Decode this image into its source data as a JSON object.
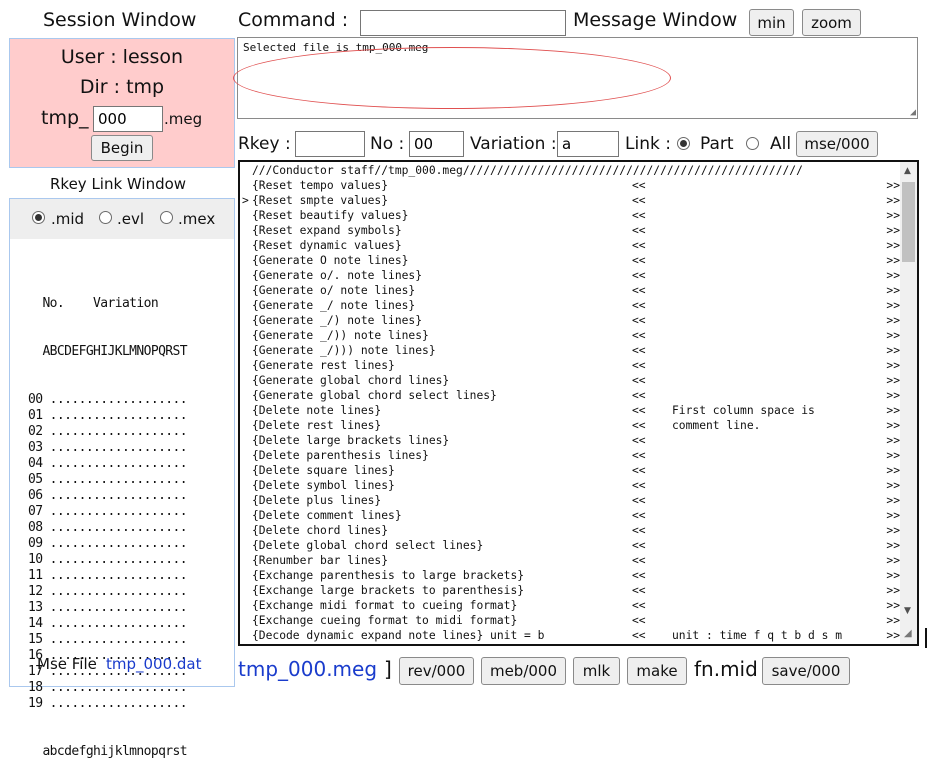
{
  "session": {
    "title": "Session Window",
    "user_label": "User : lesson",
    "dir_label": "Dir : tmp",
    "file_prefix": "tmp_",
    "file_number": "000",
    "file_ext": ".meg",
    "begin_label": "Begin"
  },
  "rkey_link": {
    "title": "Rkey Link Window",
    "options": [
      {
        "label": ".mid",
        "selected": true
      },
      {
        "label": ".evl",
        "selected": false
      },
      {
        "label": ".mex",
        "selected": false
      }
    ],
    "header_line1": "  No.    Variation",
    "header_line2": "  ABCDEFGHIJKLMNOPQRST",
    "rows": [
      "00 ...................",
      "01 ...................",
      "02 ...................",
      "03 ...................",
      "04 ...................",
      "05 ...................",
      "06 ...................",
      "07 ...................",
      "08 ...................",
      "09 ...................",
      "10 ...................",
      "11 ...................",
      "12 ...................",
      "13 ...................",
      "14 ...................",
      "15 ...................",
      "16 ...................",
      "17 ...................",
      "18 ...................",
      "19 ..................."
    ],
    "footer_line": "  abcdefghijklmnopqrst",
    "mse_file_label": "Mse File",
    "mse_file_link": "tmp_000.dat"
  },
  "command": {
    "label": "Command :",
    "value": ""
  },
  "message_window": {
    "label": "Message Window",
    "min_label": "min",
    "zoom_label": "zoom",
    "text": "Selected file is tmp_000.meg"
  },
  "controls": {
    "rkey_label": "Rkey :",
    "rkey_value": "",
    "no_label": "No :",
    "no_value": "00",
    "variation_label": "Variation :",
    "variation_value": "a",
    "link_label": "Link :",
    "part_label": "Part",
    "all_label": "All",
    "part_selected": true,
    "mse_button": "mse/000"
  },
  "editor": {
    "lines": [
      {
        "p": " ",
        "a": "///Conductor staff//tmp_000.meg//////////////////////////////////////////////////",
        "b": "",
        "c": "",
        "d": ""
      },
      {
        "p": " ",
        "a": "{Reset tempo values}",
        "b": "<<",
        "c": "",
        "d": ">>"
      },
      {
        "p": ">",
        "a": "{Reset smpte values}",
        "b": "<<",
        "c": "",
        "d": ">>"
      },
      {
        "p": " ",
        "a": "{Reset beautify values}",
        "b": "<<",
        "c": "",
        "d": ">>"
      },
      {
        "p": " ",
        "a": "{Reset expand symbols}",
        "b": "<<",
        "c": "",
        "d": ">>"
      },
      {
        "p": " ",
        "a": "{Reset dynamic values}",
        "b": "<<",
        "c": "",
        "d": ">>"
      },
      {
        "p": " ",
        "a": "{Generate O note lines}",
        "b": "<<",
        "c": "",
        "d": ">>"
      },
      {
        "p": " ",
        "a": "{Generate o/. note lines}",
        "b": "<<",
        "c": "",
        "d": ">>"
      },
      {
        "p": " ",
        "a": "{Generate o/ note lines}",
        "b": "<<",
        "c": "",
        "d": ">>"
      },
      {
        "p": " ",
        "a": "{Generate _/ note lines}",
        "b": "<<",
        "c": "",
        "d": ">>"
      },
      {
        "p": " ",
        "a": "{Generate _/) note lines}",
        "b": "<<",
        "c": "",
        "d": ">>"
      },
      {
        "p": " ",
        "a": "{Generate _/)) note lines}",
        "b": "<<",
        "c": "",
        "d": ">>"
      },
      {
        "p": " ",
        "a": "{Generate _/))) note lines}",
        "b": "<<",
        "c": "",
        "d": ">>"
      },
      {
        "p": " ",
        "a": "{Generate rest lines}",
        "b": "<<",
        "c": "",
        "d": ">>"
      },
      {
        "p": " ",
        "a": "{Generate global chord lines}",
        "b": "<<",
        "c": "",
        "d": ">>"
      },
      {
        "p": " ",
        "a": "{Generate global chord select lines}",
        "b": "<<",
        "c": "",
        "d": ">>"
      },
      {
        "p": " ",
        "a": "{Delete note lines}",
        "b": "<<",
        "c": "First column space is",
        "d": ">>"
      },
      {
        "p": " ",
        "a": "{Delete rest lines}",
        "b": "<<",
        "c": "comment line.",
        "d": ">>"
      },
      {
        "p": " ",
        "a": "{Delete large brackets lines}",
        "b": "<<",
        "c": "",
        "d": ">>"
      },
      {
        "p": " ",
        "a": "{Delete parenthesis lines}",
        "b": "<<",
        "c": "",
        "d": ">>"
      },
      {
        "p": " ",
        "a": "{Delete square lines}",
        "b": "<<",
        "c": "",
        "d": ">>"
      },
      {
        "p": " ",
        "a": "{Delete symbol lines}",
        "b": "<<",
        "c": "",
        "d": ">>"
      },
      {
        "p": " ",
        "a": "{Delete plus lines}",
        "b": "<<",
        "c": "",
        "d": ">>"
      },
      {
        "p": " ",
        "a": "{Delete comment lines}",
        "b": "<<",
        "c": "",
        "d": ">>"
      },
      {
        "p": " ",
        "a": "{Delete chord lines}",
        "b": "<<",
        "c": "",
        "d": ">>"
      },
      {
        "p": " ",
        "a": "{Delete global chord select lines}",
        "b": "<<",
        "c": "",
        "d": ">>"
      },
      {
        "p": " ",
        "a": "{Renumber bar lines}",
        "b": "<<",
        "c": "",
        "d": ">>"
      },
      {
        "p": " ",
        "a": "{Exchange parenthesis to large brackets}",
        "b": "<<",
        "c": "",
        "d": ">>"
      },
      {
        "p": " ",
        "a": "{Exchange large brackets to parenthesis}",
        "b": "<<",
        "c": "",
        "d": ">>"
      },
      {
        "p": " ",
        "a": "{Exchange midi format to cueing format}",
        "b": "<<",
        "c": "",
        "d": ">>"
      },
      {
        "p": " ",
        "a": "{Exchange cueing format to midi format}",
        "b": "<<",
        "c": "",
        "d": ">>"
      },
      {
        "p": " ",
        "a": "{Decode dynamic expand note lines} unit = b",
        "b": "<<",
        "c": "unit : time f q t b d s m",
        "d": ">>"
      }
    ]
  },
  "bottom": {
    "file_name": "tmp_000.meg",
    "bracket": "]",
    "rev_button": "rev/000",
    "meb_button": "meb/000",
    "mlk_button": "mlk",
    "make_button": "make",
    "fn_label": "fn.mid",
    "save_button": "save/000"
  }
}
